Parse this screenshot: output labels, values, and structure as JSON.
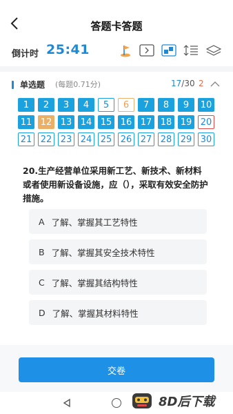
{
  "header": {
    "title": "答题卡答题"
  },
  "timer": {
    "label": "倒计时",
    "value": "25:41"
  },
  "toolbar": {
    "icons": [
      "flag-icon",
      "play-icon",
      "answer-card-icon",
      "font-size-icon",
      "layers-icon"
    ]
  },
  "section": {
    "title": "单选题",
    "subtitle": "(每题0.71分)",
    "progress_current": "17",
    "progress_total": "/30",
    "wrong_count": "2"
  },
  "answer_card": {
    "total": 30,
    "cells": [
      {
        "n": "1",
        "state": "done"
      },
      {
        "n": "2",
        "state": "done"
      },
      {
        "n": "3",
        "state": "done"
      },
      {
        "n": "4",
        "state": "done"
      },
      {
        "n": "5",
        "state": "empty"
      },
      {
        "n": "6",
        "state": "marked"
      },
      {
        "n": "7",
        "state": "done"
      },
      {
        "n": "8",
        "state": "done"
      },
      {
        "n": "9",
        "state": "done"
      },
      {
        "n": "10",
        "state": "done"
      },
      {
        "n": "11",
        "state": "done"
      },
      {
        "n": "12",
        "state": "markdone"
      },
      {
        "n": "13",
        "state": "done"
      },
      {
        "n": "14",
        "state": "done"
      },
      {
        "n": "15",
        "state": "done"
      },
      {
        "n": "16",
        "state": "done"
      },
      {
        "n": "17",
        "state": "done"
      },
      {
        "n": "18",
        "state": "done"
      },
      {
        "n": "19",
        "state": "done"
      },
      {
        "n": "20",
        "state": "current"
      },
      {
        "n": "21",
        "state": "empty"
      },
      {
        "n": "22",
        "state": "empty"
      },
      {
        "n": "23",
        "state": "empty"
      },
      {
        "n": "24",
        "state": "empty"
      },
      {
        "n": "25",
        "state": "empty"
      },
      {
        "n": "26",
        "state": "empty"
      },
      {
        "n": "27",
        "state": "empty"
      },
      {
        "n": "28",
        "state": "empty"
      },
      {
        "n": "29",
        "state": "empty"
      },
      {
        "n": "30",
        "state": "empty"
      }
    ]
  },
  "question": {
    "text": "20.生产经营单位采用新工艺、新技术、新材料或者使用新设备设施，应（），采取有效安全防护措施。",
    "options": [
      {
        "letter": "A",
        "text": "了解、掌握其工艺特性"
      },
      {
        "letter": "B",
        "text": "了解、掌握其安全技术特性"
      },
      {
        "letter": "C",
        "text": "了解、掌握其结构特性"
      },
      {
        "letter": "D",
        "text": "了解、掌握其材料特性"
      }
    ]
  },
  "submit": {
    "label": "交卷"
  },
  "watermark": {
    "text": "8D后下载"
  },
  "colors": {
    "primary": "#1e8ad6",
    "done": "#1aa1de",
    "marked": "#eab068",
    "current_border": "#e24a4a",
    "wrong": "#e96a4a"
  }
}
